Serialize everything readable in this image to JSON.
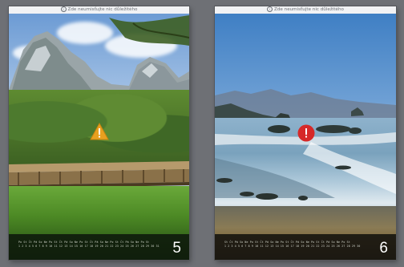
{
  "pages": [
    {
      "number": "5",
      "warning_text": "Zde neumisťujte nic důležitého",
      "status_icon": "warning-triangle-icon",
      "accent": "#e8a020",
      "calendar": {
        "row1": "Po St Čt Pá So Ne Po St Čt Pá So Ne Po St Čt Pá So Ne Po St Čt Pá So Ne Po St",
        "row2": "1 2 3 4 5 6 7 8 9 10 11 12 13 14 15 16 17 18 19 20 21 22 23 24 25 26 27 28 29 30 31"
      }
    },
    {
      "number": "6",
      "warning_text": "Zde neumisťujte nic důležitého",
      "status_icon": "error-circle-icon",
      "accent": "#d62828",
      "calendar": {
        "row1": "St Čt Pá So Ne Po St Čt Pá So Ne Po St Čt Pá So Ne Po St Čt Pá So Ne Po St",
        "row2": "1 2 3 4 5 6 7 8 9 10 11 12 13 14 15 16 17 18 19 20 21 22 23 24 25 26 27 28 29 30"
      }
    }
  ]
}
